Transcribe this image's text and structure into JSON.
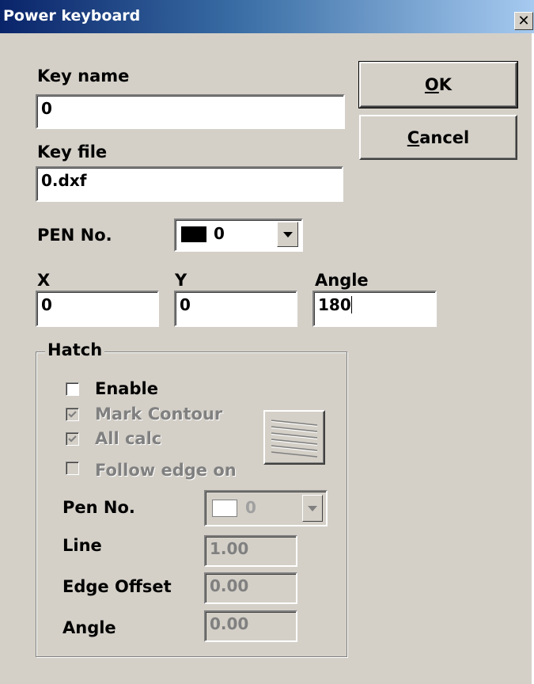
{
  "window": {
    "title": "Power keyboard",
    "close_glyph": "✕"
  },
  "key_name": {
    "label": "Key name",
    "value": "0"
  },
  "key_file": {
    "label": "Key file",
    "value": "0.dxf"
  },
  "buttons": {
    "ok": {
      "mnemonic": "O",
      "rest": "K"
    },
    "cancel": {
      "mnemonic": "C",
      "rest": "ancel"
    }
  },
  "pen": {
    "label": "PEN No.",
    "value": "0",
    "color": "#000000"
  },
  "coords": {
    "x": {
      "label": "X",
      "value": "0"
    },
    "y": {
      "label": "Y",
      "value": "0"
    },
    "angle": {
      "label": "Angle",
      "value": "180"
    }
  },
  "hatch": {
    "legend": "Hatch",
    "enable": {
      "label": "Enable",
      "checked": false
    },
    "mark_contour": {
      "label": "Mark Contour",
      "checked": true
    },
    "all_calc": {
      "label": "All calc",
      "checked": true
    },
    "follow_edge": {
      "label": "Follow edge on",
      "checked": false
    },
    "pen_no": {
      "label": "Pen No.",
      "value": "0",
      "color": "#ffffff"
    },
    "line": {
      "label": "Line",
      "value": "1.00"
    },
    "edge_offset": {
      "label": "Edge Offset",
      "value": "0.00"
    },
    "angle": {
      "label": "Angle",
      "value": "0.00"
    },
    "pattern_icon": "hatch-pattern-icon"
  }
}
